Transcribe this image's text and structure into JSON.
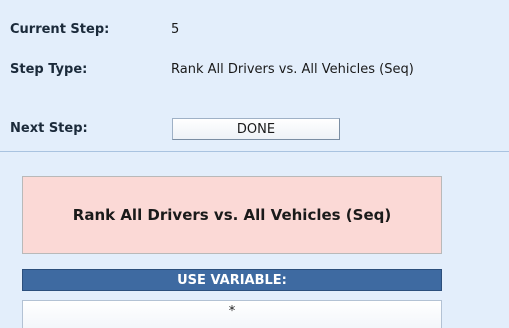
{
  "info": {
    "current_step_label": "Current Step:",
    "current_step_value": "5",
    "step_type_label": "Step Type:",
    "step_type_value": "Rank All Drivers vs. All Vehicles (Seq)",
    "next_step_label": "Next Step:",
    "next_step_button": "DONE"
  },
  "step_box": {
    "title": "Rank All Drivers vs. All Vehicles (Seq)"
  },
  "variable": {
    "header": "USE VARIABLE:",
    "value": "*"
  },
  "colors": {
    "panel_background": "#e3eefb",
    "step_box_background": "#fbd9d6",
    "variable_header_background": "#3e6aa1"
  }
}
